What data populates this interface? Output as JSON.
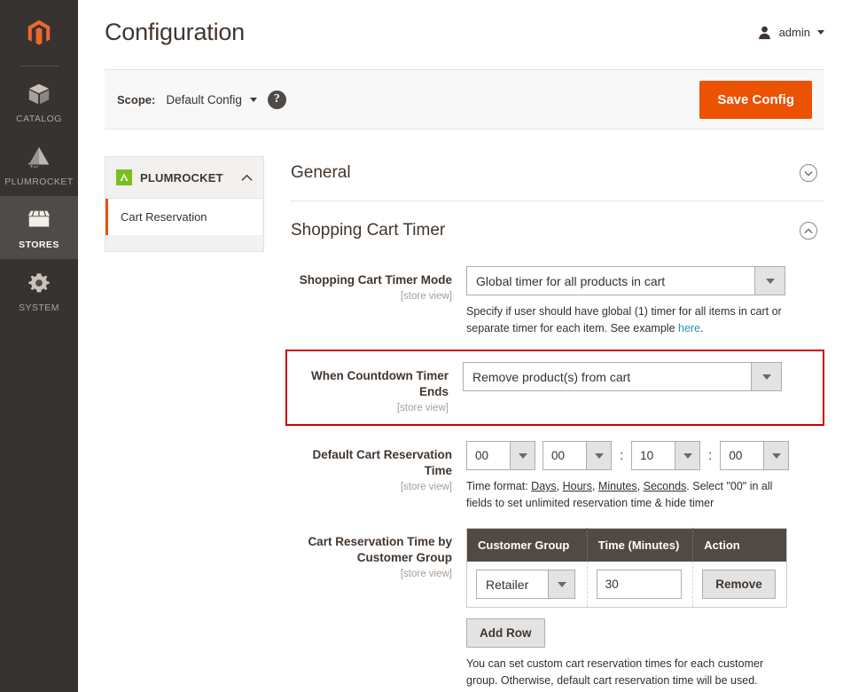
{
  "rail": {
    "logo_icon": "magento-logo-icon",
    "items": [
      {
        "label": "CATALOG",
        "icon": "box-icon",
        "active": false
      },
      {
        "label": "PLUMROCKET",
        "icon": "pyramid-icon",
        "active": false
      },
      {
        "label": "STORES",
        "icon": "storefront-icon",
        "active": true
      },
      {
        "label": "SYSTEM",
        "icon": "gear-icon",
        "active": false
      }
    ]
  },
  "header": {
    "title": "Configuration",
    "user": {
      "name": "admin",
      "icon": "user-avatar-icon",
      "caret": "chevron-down-icon"
    }
  },
  "scope_bar": {
    "label": "Scope:",
    "value": "Default Config",
    "help_icon": "question-mark-icon",
    "save_button": "Save Config"
  },
  "config_nav": {
    "group": {
      "title": "PLUMROCKET",
      "icon": "plumrocket-logo-icon",
      "chevron": "chevron-up-icon"
    },
    "items": [
      {
        "label": "Cart Reservation",
        "active": true
      }
    ]
  },
  "sections": [
    {
      "title": "General",
      "expanded": false,
      "chevron": "chevron-down-icon"
    },
    {
      "title": "Shopping Cart Timer",
      "expanded": true,
      "chevron": "chevron-up-icon"
    }
  ],
  "fields": {
    "timer_mode": {
      "label": "Shopping Cart Timer Mode",
      "scope": "[store view]",
      "value": "Global timer for all products in cart",
      "help_pre": "Specify if user should have global (1) timer for all items in cart or separate timer for each item. See example ",
      "help_link": "here",
      "help_post": "."
    },
    "countdown_ends": {
      "label": "When Countdown Timer Ends",
      "scope": "[store view]",
      "value": "Remove product(s) from cart",
      "highlight_color": "#cc0000"
    },
    "default_time": {
      "label": "Default Cart Reservation Time",
      "scope": "[store view]",
      "days": "00",
      "hours": "00",
      "minutes": "10",
      "seconds": "00",
      "sep1": ":",
      "sep2": ":",
      "help_pre": "Time format: ",
      "help_u1": "Days",
      "help_c1": ", ",
      "help_u2": "Hours",
      "help_c2": ", ",
      "help_u3": "Minutes",
      "help_c3": ", ",
      "help_u4": "Seconds",
      "help_post": ". Select \"00\" in all fields to set unlimited reservation time & hide timer"
    },
    "by_group": {
      "label": "Cart Reservation Time by Customer Group",
      "scope": "[store view]",
      "columns": [
        "Customer Group",
        "Time (Minutes)",
        "Action"
      ],
      "rows": [
        {
          "customer_group": "Retailer",
          "time_minutes": "30",
          "action": "Remove"
        }
      ],
      "add_row_button": "Add Row",
      "help": "You can set custom cart reservation times for each customer group. Otherwise, default cart reservation time will be used."
    }
  }
}
